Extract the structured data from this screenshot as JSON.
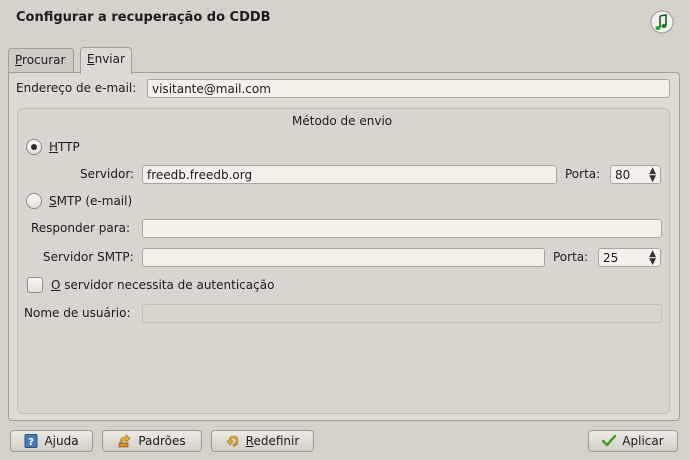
{
  "window": {
    "title": "Configurar a recuperação do CDDB"
  },
  "tabs": [
    {
      "label_ul": "P",
      "label_rest": "rocurar",
      "active": false
    },
    {
      "label_ul": "E",
      "label_rest": "nviar",
      "active": true
    }
  ],
  "email": {
    "label": "Endereço de e-mail:",
    "value": "visitante@mail.com"
  },
  "method": {
    "title": "Método de envio",
    "http": {
      "label_ul": "H",
      "label_rest": "TTP",
      "selected": true,
      "server_label": "Servidor:",
      "server_value": "freedb.freedb.org",
      "port_label": "Porta:",
      "port_value": "80"
    },
    "smtp": {
      "label_ul": "S",
      "label_rest": "MTP (e-mail)",
      "selected": false,
      "reply_label": "Responder para:",
      "reply_value": "",
      "server_label": "Servidor SMTP:",
      "server_value": "",
      "port_label": "Porta:",
      "port_value": "25"
    },
    "auth": {
      "label_ul": "O",
      "label_rest": " servidor necessita de autenticação",
      "checked": false
    },
    "username": {
      "label": "Nome de usuário:",
      "value": ""
    }
  },
  "buttons": {
    "help": {
      "label_ul": "",
      "label_rest": "Ajuda",
      "icon": "help-icon"
    },
    "defaults": {
      "label_ul": "",
      "label_rest": "Padrões",
      "icon": "defaults-icon"
    },
    "reset": {
      "label_ul": "R",
      "label_rest": "edefinir",
      "icon": "reset-icon"
    },
    "apply": {
      "label_ul": "",
      "label_rest": "Aplicar",
      "icon": "checkmark-icon"
    }
  },
  "colors": {
    "background": "#d6d2ca",
    "input": "#f5f1ea",
    "apply_check": "#3a9a2a"
  }
}
